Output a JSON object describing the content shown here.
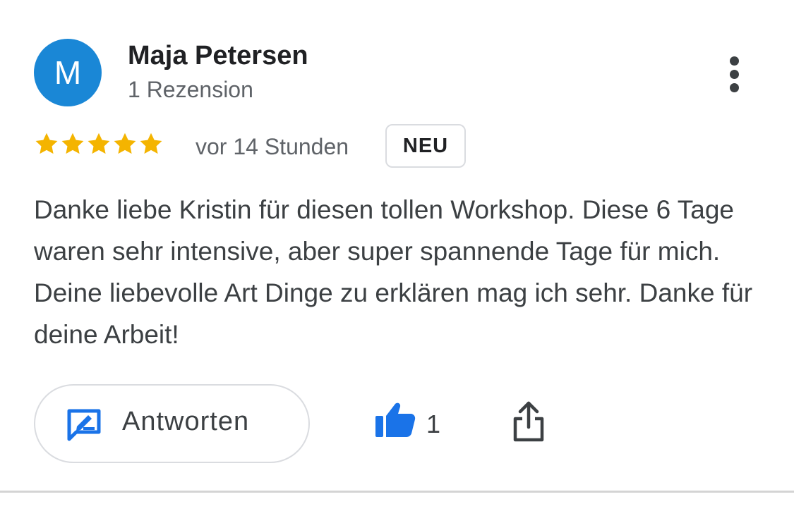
{
  "review": {
    "author_initial": "M",
    "author_name": "Maja Petersen",
    "review_count": "1 Rezension",
    "rating": 5,
    "rating_max": 5,
    "date": "vor 14 Stunden",
    "badge": "NEU",
    "text": "Danke liebe Kristin für diesen tollen Workshop. Diese 6 Tage waren sehr intensive, aber super spannende Tage für mich. Deine liebevolle Art Dinge zu erklären mag ich sehr. Danke für deine Arbeit!"
  },
  "actions": {
    "reply_label": "Antworten",
    "like_count": "1"
  },
  "icons": {
    "more": "more-vertical-icon",
    "star": "star-icon",
    "reply": "reply-edit-icon",
    "like": "thumbs-up-icon",
    "share": "share-icon"
  },
  "colors": {
    "avatar_bg": "#1a87d6",
    "star": "#f4b400",
    "accent_blue": "#1a73e8",
    "text_primary": "#202124",
    "text_secondary": "#5f6368",
    "border": "#dadce0"
  }
}
